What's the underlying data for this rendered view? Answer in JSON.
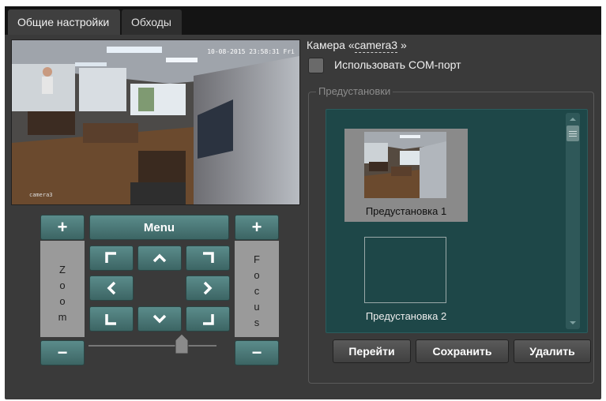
{
  "tabs": [
    {
      "label": "Общие настройки",
      "active": true
    },
    {
      "label": "Обходы",
      "active": false
    }
  ],
  "video": {
    "timestamp": "10-08-2015 23:58:31 Fri",
    "camera_overlay": "camera3"
  },
  "ptz": {
    "zoom_plus": "+",
    "zoom_minus": "−",
    "menu_label": "Menu",
    "focus_plus": "+",
    "focus_minus": "−",
    "zoom_label": [
      "Z",
      "o",
      "o",
      "m"
    ],
    "focus_label": [
      "F",
      "o",
      "c",
      "u",
      "s"
    ],
    "slider_value_fraction": 0.73
  },
  "camera": {
    "prefix": "Камера «",
    "name": "camera3",
    "suffix": " »",
    "use_com_port_label": "Использовать COM-порт",
    "use_com_port_checked": false
  },
  "presets": {
    "group_title": "Предустановки",
    "items": [
      {
        "label": "Предустановка 1",
        "selected": true,
        "has_thumbnail": true
      },
      {
        "label": "Предустановка 2",
        "selected": false,
        "has_thumbnail": false
      }
    ],
    "buttons": {
      "go": "Перейти",
      "save": "Сохранить",
      "delete": "Удалить"
    }
  },
  "colors": {
    "accent_teal": "#4a7978",
    "list_background": "#1e4748",
    "panel_background": "#3a3a3a"
  }
}
